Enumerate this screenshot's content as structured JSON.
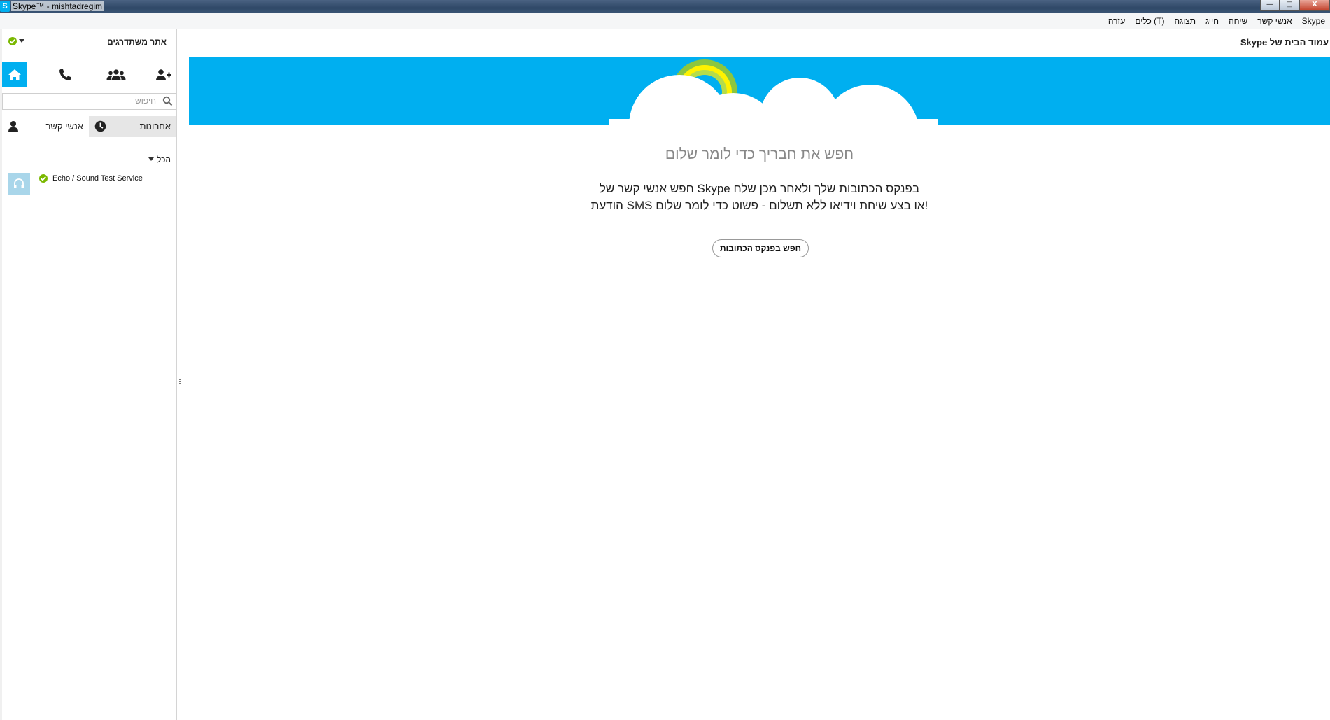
{
  "window": {
    "title": "Skype™ - mishtadregim",
    "app_icon_letter": "S",
    "controls": {
      "minimize": "—",
      "maximize": "□",
      "close": "X"
    }
  },
  "menu": [
    "Skype",
    "אנשי קשר",
    "שיחה",
    "חייג",
    "תצוגה",
    "כלים (T)",
    "עזרה"
  ],
  "sidebar": {
    "profile_name": "אתר משתדרגים",
    "search_placeholder": "חיפוש",
    "tabs": {
      "recent": "אחרונות",
      "contacts": "אנשי קשר"
    },
    "filter_label": "הכל",
    "contacts": [
      {
        "name": "Echo / Sound Test Service"
      }
    ],
    "icons": {
      "home": "home-icon",
      "call": "phone-icon",
      "group": "group-icon",
      "add_contact": "add-contact-icon"
    }
  },
  "main": {
    "page_title": "עמוד הבית של Skype",
    "headline": "חפש את חבריך כדי לומר שלום",
    "body_line1": "בפנקס הכתובות שלך ולאחר מכן שלח  Skype חפש אנשי קשר של",
    "body_line2": "!או בצע שיחת וידיאו ללא תשלום - פשוט כדי לומר שלום SMS הודעת",
    "button_label": "חפש בפנקס הכתובות"
  },
  "colors": {
    "accent": "#00aff0",
    "presence_green": "#7ab800",
    "avatar_bg": "#a9d6ea",
    "tab_inactive": "#e6e6e6"
  }
}
